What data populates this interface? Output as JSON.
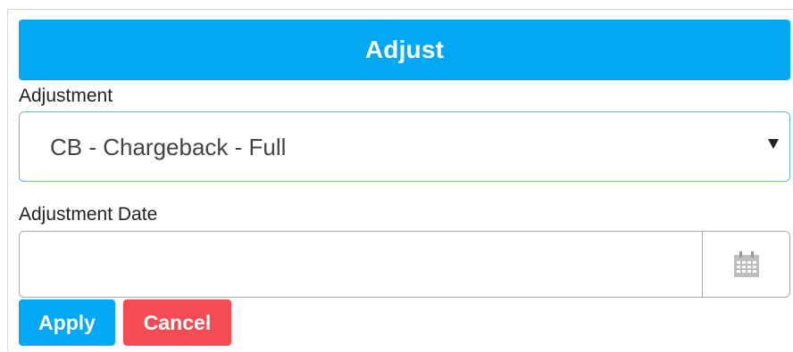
{
  "form": {
    "title": "Adjust",
    "adjustment_label": "Adjustment",
    "adjustment_value": "CB - Chargeback - Full",
    "date_label": "Adjustment Date",
    "date_value": "",
    "calendar_icon": "calendar-icon",
    "dropdown_icon": "caret-down-icon"
  },
  "buttons": {
    "apply_label": "Apply",
    "cancel_label": "Cancel"
  },
  "colors": {
    "primary": "#02a8f3",
    "danger": "#f44c55",
    "select_border": "#66aff0"
  }
}
